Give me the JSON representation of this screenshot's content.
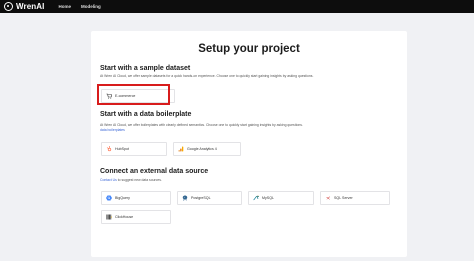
{
  "app": {
    "brand": "WrenAI"
  },
  "nav": {
    "items": [
      "Home",
      "Modeling"
    ]
  },
  "page": {
    "title": "Setup your project"
  },
  "sections": {
    "sample": {
      "title": "Start with a sample dataset",
      "desc_before": "At Wren AI Cloud, we offer sample datasets for a quick hands-on experience. Choose one to quickly start gaining insights by asking questions.",
      "tiles": [
        {
          "label": "E-commerce",
          "icon": "cart-icon"
        }
      ]
    },
    "boilerplate": {
      "title": "Start with a data boilerplate",
      "desc_before": "At Wren AI Cloud, we offer boilerplates with clearly defined semantics. Choose one to quickly start gaining insights by asking questions.",
      "desc_link": "data boilerplates",
      "tiles": [
        {
          "label": "HubSpot",
          "icon": "hubspot-icon"
        },
        {
          "label": "Google Analytics 4",
          "icon": "google-analytics-icon"
        }
      ]
    },
    "external": {
      "title": "Connect an external data source",
      "desc_link": "Contact Us",
      "desc_after": "to suggest new data sources.",
      "tiles": [
        {
          "label": "BigQuery",
          "icon": "bigquery-icon"
        },
        {
          "label": "PostgreSQL",
          "icon": "postgresql-icon"
        },
        {
          "label": "MySQL",
          "icon": "mysql-icon"
        },
        {
          "label": "SQL Server",
          "icon": "sql-server-icon"
        },
        {
          "label": "ClickHouse",
          "icon": "clickhouse-icon"
        }
      ]
    }
  },
  "colors": {
    "accent_link": "#3a66d6",
    "highlight": "#d81c1c",
    "nav_bg": "#0d0d0d"
  }
}
